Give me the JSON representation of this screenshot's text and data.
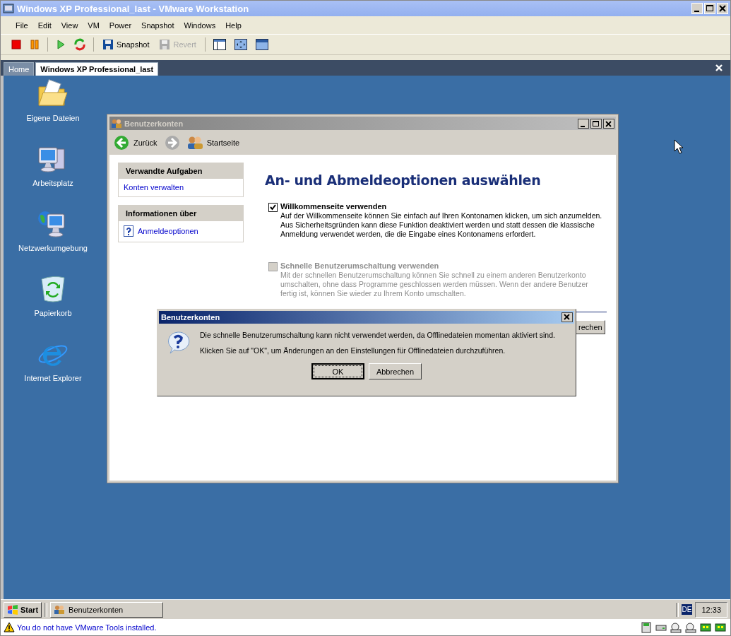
{
  "vmware": {
    "title": "Windows XP Professional_last - VMware Workstation",
    "menu": [
      "File",
      "Edit",
      "View",
      "VM",
      "Power",
      "Snapshot",
      "Windows",
      "Help"
    ],
    "toolbar": [
      {
        "label": "Snapshot",
        "disabled": false
      },
      {
        "label": "Revert",
        "disabled": true
      }
    ],
    "tabs": [
      {
        "label": "Home",
        "selected": false
      },
      {
        "label": "Windows XP Professional_last",
        "selected": true
      }
    ]
  },
  "desktop_icons": [
    {
      "label": "Eigene Dateien"
    },
    {
      "label": "Arbeitsplatz"
    },
    {
      "label": "Netzwerkumgebung"
    },
    {
      "label": "Papierkorb"
    },
    {
      "label": "Internet Explorer"
    }
  ],
  "window": {
    "title": "Benutzerkonten",
    "back": "Zurück",
    "home": "Startseite",
    "panels": [
      {
        "title": "Verwandte Aufgaben",
        "links": [
          {
            "label": "Konten verwalten",
            "help": false
          }
        ]
      },
      {
        "title": "Informationen über",
        "links": [
          {
            "label": "Anmeldeoptionen",
            "help": true
          }
        ]
      }
    ],
    "heading": "An- und Abmeldeoptionen auswählen",
    "options": [
      {
        "label": "Willkommenseite verwenden",
        "checked": true,
        "disabled": false,
        "description": "Auf der Willkommenseite können Sie einfach auf Ihren Kontonamen klicken, um sich anzumelden. Aus Sicherheitsgründen kann diese Funktion deaktiviert werden und statt dessen die klassische Anmeldung verwendet werden, die die Eingabe eines Kontonamens erfordert."
      },
      {
        "label": "Schnelle Benutzerumschaltung verwenden",
        "checked": false,
        "disabled": true,
        "description": "Mit der schnellen Benutzerumschaltung können Sie schnell zu einem anderen Benutzerkonto umschalten, ohne dass Programme geschlossen werden müssen. Wenn der andere Benutzer fertig ist, können Sie wieder zu Ihrem Konto umschalten."
      }
    ],
    "partial_button": "rechen"
  },
  "dialog": {
    "title": "Benutzerkonten",
    "messages": [
      "Die schnelle Benutzerumschaltung kann nicht verwendet werden, da Offlinedateien momentan aktiviert sind.",
      "Klicken Sie auf \"OK\", um Änderungen an den Einstellungen für Offlinedateien durchzuführen."
    ],
    "buttons": [
      {
        "label": "OK",
        "focused": true
      },
      {
        "label": "Abbrechen",
        "focused": false
      }
    ]
  },
  "taskbar": {
    "start": "Start",
    "tasks": [
      {
        "label": "Benutzerkonten",
        "selected": false
      }
    ],
    "language": "DE",
    "clock": "12:33"
  },
  "status_bar": {
    "message": "You do not have VMware Tools installed."
  }
}
